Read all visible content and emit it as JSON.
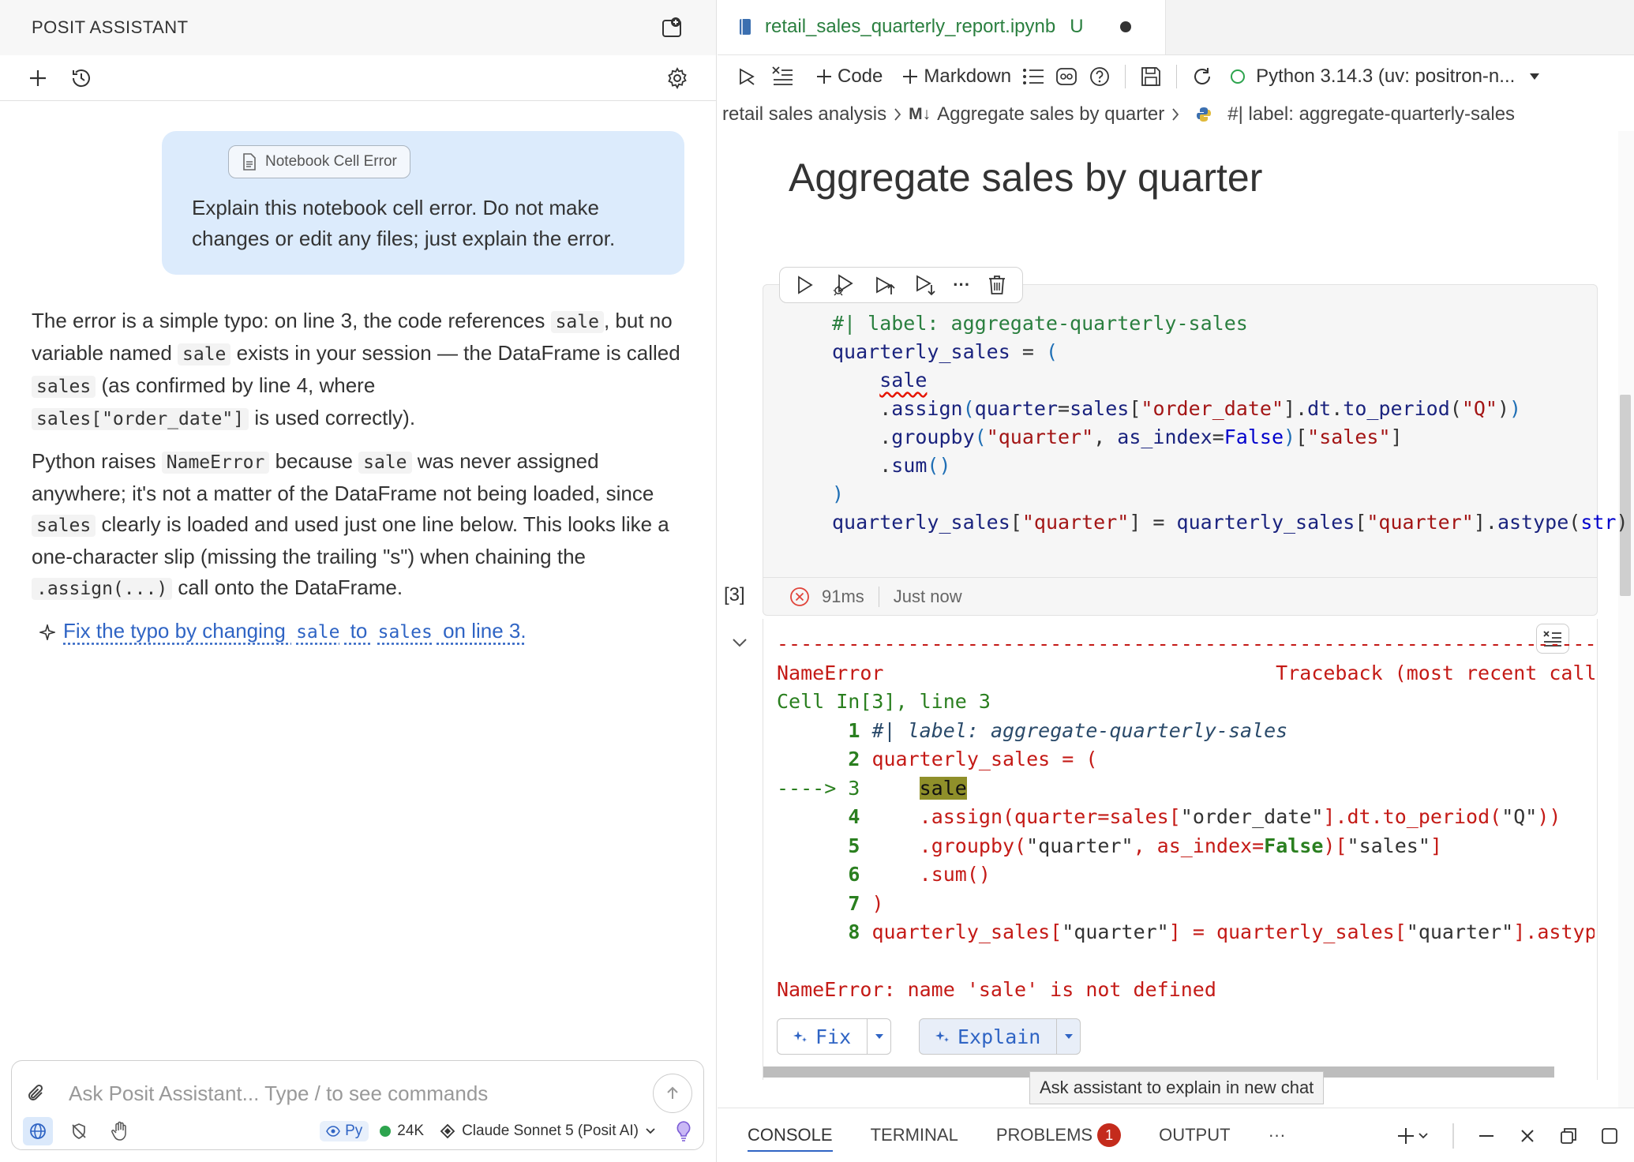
{
  "assistant": {
    "title": "POSIT ASSISTANT",
    "user_message": {
      "chip_label": "Notebook Cell Error",
      "text": "Explain this notebook cell error. Do not make changes or edit any files; just explain the error."
    },
    "response": {
      "p1_a": "The error is a simple typo: on line 3, the code references ",
      "p1_code1": "sale",
      "p1_b": ", but no variable named ",
      "p1_code2": "sale",
      "p1_c": " exists in your session — the DataFrame is called ",
      "p1_code3": "sales",
      "p1_d": " (as confirmed by line 4, where ",
      "p1_code4": "sales[\"order_date\"]",
      "p1_e": " is used correctly).",
      "p2_a": "Python raises ",
      "p2_code1": "NameError",
      "p2_b": " because ",
      "p2_code2": "sale",
      "p2_c": " was never assigned anywhere; it's not a matter of the DataFrame not being loaded, since ",
      "p2_code3": "sales",
      "p2_d": " clearly is loaded and used just one line below. This looks like a one-character slip (missing the trailing \"s\") when chaining the ",
      "p2_code4": ".assign(...)",
      "p2_e": " call onto the DataFrame.",
      "suggestion_a": "Fix the typo by changing ",
      "suggestion_code1": "sale",
      "suggestion_b": " to ",
      "suggestion_code2": "sales",
      "suggestion_c": " on line 3."
    },
    "input": {
      "placeholder": "Ask Posit Assistant... Type / to see commands",
      "language": "Py",
      "tokens": "24K",
      "model": "Claude Sonnet 5 (Posit AI)"
    }
  },
  "editor": {
    "tab": {
      "filename": "retail_sales_quarterly_report.ipynb",
      "status": "U"
    },
    "toolbar": {
      "code_label": "Code",
      "markdown_label": "Markdown",
      "kernel": "Python 3.14.3 (uv: positron-n..."
    },
    "breadcrumb": {
      "part1": "retail sales analysis",
      "part2": "Aggregate sales by quarter",
      "part3": "#| label: aggregate-quarterly-sales"
    },
    "markdown_heading": "Aggregate sales by quarter",
    "cell": {
      "execution_count": "[3]",
      "duration": "91ms",
      "when": "Just now"
    },
    "output": {
      "error_line": "NameError: name 'sale' is not defined",
      "fix_label": "Fix",
      "explain_label": "Explain",
      "tooltip": "Ask assistant to explain in new chat"
    },
    "panel_tabs": {
      "console": "CONSOLE",
      "terminal": "TERMINAL",
      "problems": "PROBLEMS",
      "problems_count": "1",
      "output": "OUTPUT",
      "more": "···"
    }
  },
  "colors": {
    "accent": "#2f64c4",
    "error": "#c41a16",
    "success": "#2da44e",
    "bubble": "#dcebfc"
  }
}
